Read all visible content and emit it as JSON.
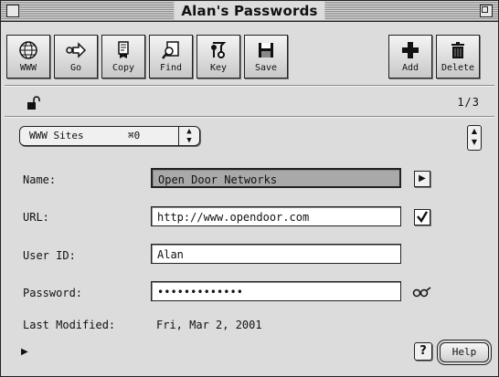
{
  "window": {
    "title": "Alan's Passwords"
  },
  "toolbar": {
    "buttons": [
      {
        "label": "WWW",
        "icon": "globe-icon"
      },
      {
        "label": "Go",
        "icon": "go-arrow-icon"
      },
      {
        "label": "Copy",
        "icon": "copy-icon"
      },
      {
        "label": "Find",
        "icon": "find-icon"
      },
      {
        "label": "Key",
        "icon": "key-icon"
      },
      {
        "label": "Save",
        "icon": "floppy-disk-icon"
      },
      {
        "label": "Add",
        "icon": "plus-icon"
      },
      {
        "label": "Delete",
        "icon": "trash-icon"
      }
    ]
  },
  "status": {
    "counter": "1/3"
  },
  "category": {
    "selected": "WWW Sites",
    "shortcut": "⌘0"
  },
  "form": {
    "name": {
      "label": "Name:",
      "value": "Open Door Networks"
    },
    "url": {
      "label": "URL:",
      "value": "http://www.opendoor.com"
    },
    "user_id": {
      "label": "User ID:",
      "value": "Alan"
    },
    "password": {
      "label": "Password:",
      "value": "•••••••••••••"
    },
    "last_modified": {
      "label": "Last Modified:",
      "value": "Fri, Mar 2, 2001"
    }
  },
  "footer": {
    "help_icon": "?",
    "help_label": "Help"
  }
}
